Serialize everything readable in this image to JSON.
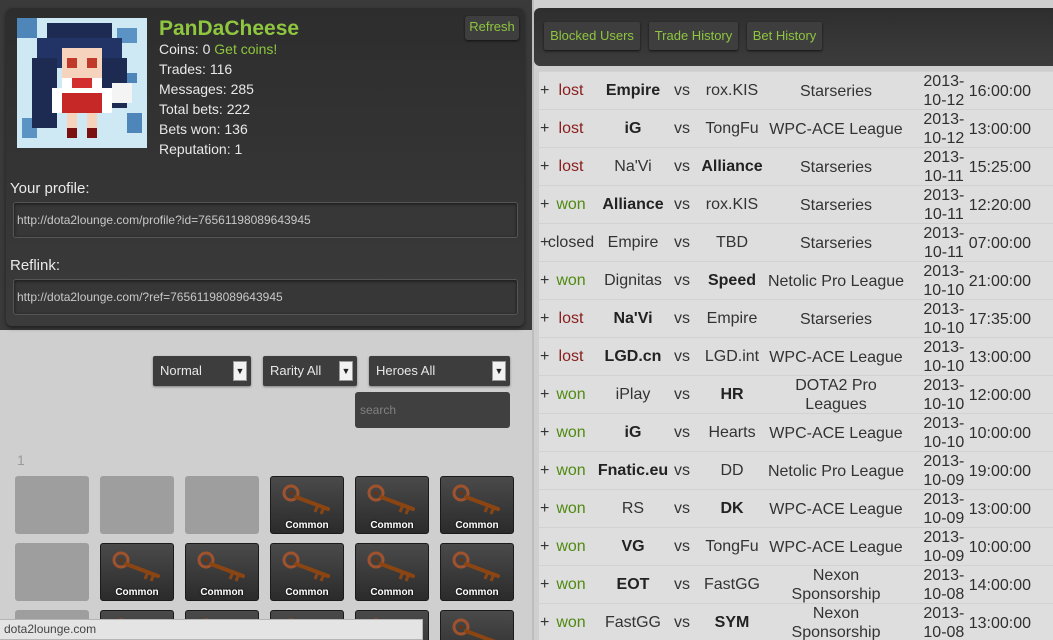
{
  "profile": {
    "username": "PanDaCheese",
    "coins_label": "Coins:",
    "coins_value": "0",
    "get_coins_label": "Get coins!",
    "trades_label": "Trades:",
    "trades_value": "116",
    "messages_label": "Messages:",
    "messages_value": "285",
    "total_bets_label": "Total bets:",
    "total_bets_value": "222",
    "bets_won_label": "Bets won:",
    "bets_won_value": "136",
    "reputation_label": "Reputation:",
    "reputation_value": "1",
    "refresh_label": "Refresh",
    "your_profile_label": "Your profile:",
    "profile_url": "http://dota2lounge.com/profile?id=76561198089643945",
    "reflink_label": "Reflink:",
    "reflink_url": "http://dota2lounge.com/?ref=76561198089643945",
    "avatar_icon": "pixel-art-anime-girl-avatar"
  },
  "filters": {
    "quality": "Normal",
    "rarity": "Rarity All",
    "heroes": "Heroes All",
    "search_placeholder": "search",
    "page": "1",
    "arrow_glyph": "▼"
  },
  "inventory": {
    "rarity_label": "Common",
    "item_icon": "key-icon",
    "rows": [
      [
        "empty",
        "empty",
        "empty",
        "item",
        "item",
        "item"
      ],
      [
        "empty",
        "item",
        "item",
        "item",
        "item",
        "item"
      ],
      [
        "empty",
        "item",
        "item",
        "item",
        "item",
        "item"
      ]
    ]
  },
  "status_bar": "dota2lounge.com",
  "tabs": {
    "blocked": "Blocked Users",
    "trade": "Trade History",
    "bet": "Bet History"
  },
  "colors": {
    "accent_green": "#8ec63f",
    "lost_red": "#8a1c1c",
    "won_green": "#4f8a10"
  },
  "history": [
    {
      "exp": "+",
      "result": "lost",
      "team1": "Empire",
      "team1_bold": true,
      "vs": "vs",
      "team2": "rox.KIS",
      "team2_bold": false,
      "league": "Starseries",
      "date": "2013-10-12",
      "time": "16:00:00"
    },
    {
      "exp": "+",
      "result": "lost",
      "team1": "iG",
      "team1_bold": true,
      "vs": "vs",
      "team2": "TongFu",
      "team2_bold": false,
      "league": "WPC-ACE League",
      "date": "2013-10-12",
      "time": "13:00:00"
    },
    {
      "exp": "+",
      "result": "lost",
      "team1": "Na'Vi",
      "team1_bold": false,
      "vs": "vs",
      "team2": "Alliance",
      "team2_bold": true,
      "league": "Starseries",
      "date": "2013-10-11",
      "time": "15:25:00"
    },
    {
      "exp": "+",
      "result": "won",
      "team1": "Alliance",
      "team1_bold": true,
      "vs": "vs",
      "team2": "rox.KIS",
      "team2_bold": false,
      "league": "Starseries",
      "date": "2013-10-11",
      "time": "12:20:00"
    },
    {
      "exp": "+",
      "result": "closed",
      "team1": "Empire",
      "team1_bold": false,
      "vs": "vs",
      "team2": "TBD",
      "team2_bold": false,
      "league": "Starseries",
      "date": "2013-10-11",
      "time": "07:00:00"
    },
    {
      "exp": "+",
      "result": "won",
      "team1": "Dignitas",
      "team1_bold": false,
      "vs": "vs",
      "team2": "Speed",
      "team2_bold": true,
      "league": "Netolic Pro League",
      "date": "2013-10-10",
      "time": "21:00:00"
    },
    {
      "exp": "+",
      "result": "lost",
      "team1": "Na'Vi",
      "team1_bold": true,
      "vs": "vs",
      "team2": "Empire",
      "team2_bold": false,
      "league": "Starseries",
      "date": "2013-10-10",
      "time": "17:35:00"
    },
    {
      "exp": "+",
      "result": "lost",
      "team1": "LGD.cn",
      "team1_bold": true,
      "vs": "vs",
      "team2": "LGD.int",
      "team2_bold": false,
      "league": "WPC-ACE League",
      "date": "2013-10-10",
      "time": "13:00:00"
    },
    {
      "exp": "+",
      "result": "won",
      "team1": "iPlay",
      "team1_bold": false,
      "vs": "vs",
      "team2": "HR",
      "team2_bold": true,
      "league": "DOTA2 Pro Leagues",
      "date": "2013-10-10",
      "time": "12:00:00"
    },
    {
      "exp": "+",
      "result": "won",
      "team1": "iG",
      "team1_bold": true,
      "vs": "vs",
      "team2": "Hearts",
      "team2_bold": false,
      "league": "WPC-ACE League",
      "date": "2013-10-10",
      "time": "10:00:00"
    },
    {
      "exp": "+",
      "result": "won",
      "team1": "Fnatic.eu",
      "team1_bold": true,
      "vs": "vs",
      "team2": "DD",
      "team2_bold": false,
      "league": "Netolic Pro League",
      "date": "2013-10-09",
      "time": "19:00:00"
    },
    {
      "exp": "+",
      "result": "won",
      "team1": "RS",
      "team1_bold": false,
      "vs": "vs",
      "team2": "DK",
      "team2_bold": true,
      "league": "WPC-ACE League",
      "date": "2013-10-09",
      "time": "13:00:00"
    },
    {
      "exp": "+",
      "result": "won",
      "team1": "VG",
      "team1_bold": true,
      "vs": "vs",
      "team2": "TongFu",
      "team2_bold": false,
      "league": "WPC-ACE League",
      "date": "2013-10-09",
      "time": "10:00:00"
    },
    {
      "exp": "+",
      "result": "won",
      "team1": "EOT",
      "team1_bold": true,
      "vs": "vs",
      "team2": "FastGG",
      "team2_bold": false,
      "league": "Nexon Sponsorship",
      "date": "2013-10-08",
      "time": "14:00:00"
    },
    {
      "exp": "+",
      "result": "won",
      "team1": "FastGG",
      "team1_bold": false,
      "vs": "vs",
      "team2": "SYM",
      "team2_bold": true,
      "league": "Nexon Sponsorship",
      "date": "2013-10-08",
      "time": "13:00:00"
    }
  ]
}
